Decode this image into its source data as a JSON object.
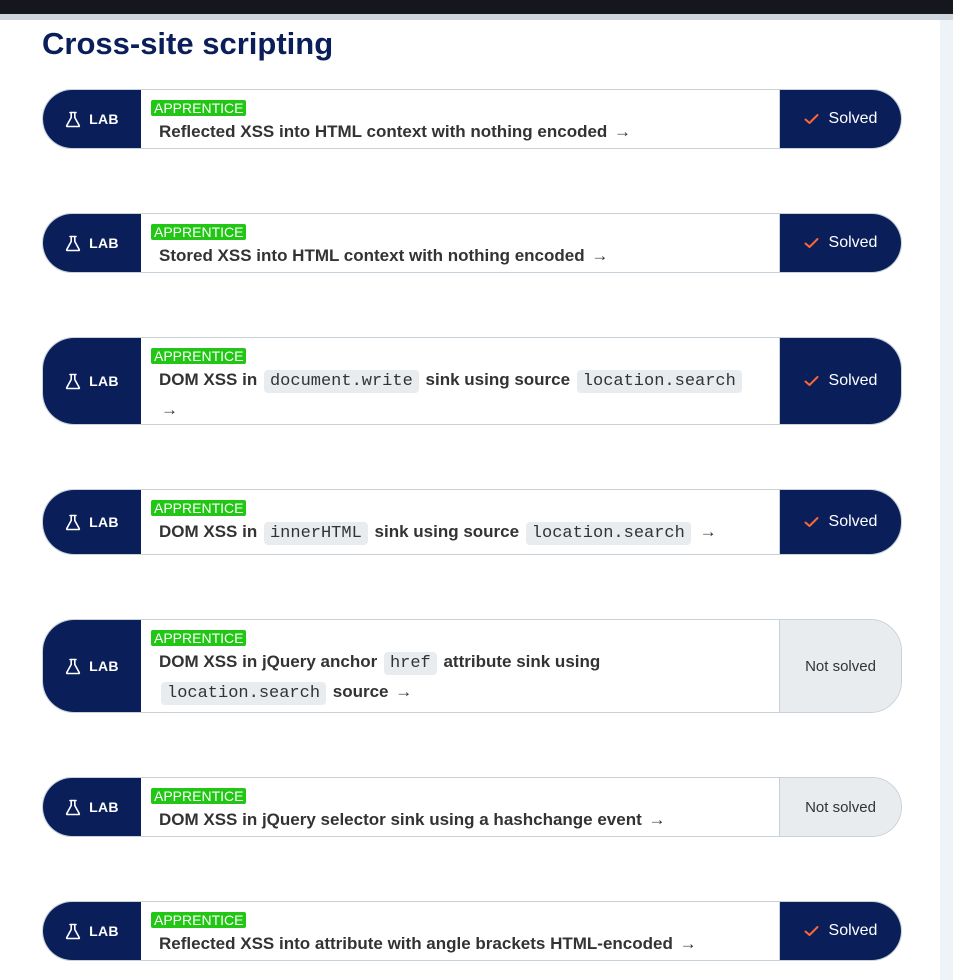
{
  "page": {
    "title": "Cross-site scripting"
  },
  "labs": [
    {
      "tag": "LAB",
      "level": "APPRENTICE",
      "title_parts": [
        {
          "text": "Reflected XSS into HTML context with nothing encoded"
        }
      ],
      "status": "Solved",
      "solved": true
    },
    {
      "tag": "LAB",
      "level": "APPRENTICE",
      "title_parts": [
        {
          "text": "Stored XSS into HTML context with nothing encoded"
        }
      ],
      "status": "Solved",
      "solved": true
    },
    {
      "tag": "LAB",
      "level": "APPRENTICE",
      "title_parts": [
        {
          "text": "DOM XSS in "
        },
        {
          "code": "document.write"
        },
        {
          "text": " sink using source "
        },
        {
          "code": "location.search"
        }
      ],
      "status": "Solved",
      "solved": true
    },
    {
      "tag": "LAB",
      "level": "APPRENTICE",
      "title_parts": [
        {
          "text": "DOM XSS in "
        },
        {
          "code": "innerHTML"
        },
        {
          "text": " sink using source "
        },
        {
          "code": "location.search"
        }
      ],
      "status": "Solved",
      "solved": true
    },
    {
      "tag": "LAB",
      "level": "APPRENTICE",
      "title_parts": [
        {
          "text": "DOM XSS in jQuery anchor "
        },
        {
          "code": "href"
        },
        {
          "text": " attribute sink using "
        },
        {
          "code": "location.search"
        },
        {
          "text": " source"
        }
      ],
      "status": "Not solved",
      "solved": false
    },
    {
      "tag": "LAB",
      "level": "APPRENTICE",
      "title_parts": [
        {
          "text": "DOM XSS in jQuery selector sink using a hashchange event"
        }
      ],
      "status": "Not solved",
      "solved": false
    },
    {
      "tag": "LAB",
      "level": "APPRENTICE",
      "title_parts": [
        {
          "text": "Reflected XSS into attribute with angle brackets HTML-encoded"
        }
      ],
      "status": "Solved",
      "solved": true
    }
  ],
  "icons": {
    "lab": "flask-icon",
    "solved": "checkmark-icon",
    "link": "arrow-right-icon"
  },
  "colors": {
    "navy": "#0a1e5a",
    "apprentice": "#21c714",
    "not_solved_bg": "#e8ecef",
    "solved_check": "#ff6633"
  }
}
